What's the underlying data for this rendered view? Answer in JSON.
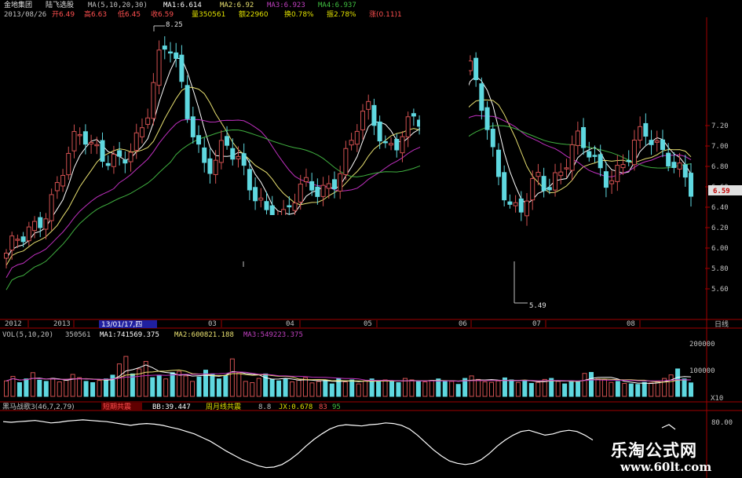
{
  "header": {
    "stock_name": "金地集团",
    "indicator_name": "陆飞选股",
    "ma_title": "MA(5,10,20,30)",
    "ma1": "MA1:6.614",
    "ma2": "MA2:6.92",
    "ma3": "MA3:6.923",
    "ma4": "MA4:6.937",
    "date": "2013/08/26",
    "open": "开6.49",
    "high": "高6.63",
    "low": "低6.45",
    "close": "收6.59",
    "volume": "量350561",
    "amount": "额22960",
    "turnover": "换0.78%",
    "amplitude": "振2.78%",
    "change": "涨(0.11)1"
  },
  "price_panel": {
    "high_label": "8.25",
    "low_label": "5.49",
    "current_price": "6.59",
    "y_ticks": [
      "7.20",
      "7.00",
      "6.80",
      "6.60",
      "6.40",
      "6.20",
      "6.00",
      "5.80",
      "5.60"
    ]
  },
  "x_axis": {
    "labels": [
      "2012",
      "2013",
      "13/01/17,四",
      "03",
      "04",
      "05",
      "06",
      "07",
      "08"
    ],
    "period": "日线"
  },
  "volume_panel": {
    "title": "VOL(5,10,20)",
    "vol": "350561",
    "ma1": "MA1:741569.375",
    "ma2": "MA2:600821.188",
    "ma3": "MA3:549223.375",
    "y_ticks": [
      "200000",
      "100000"
    ],
    "unit": "X10"
  },
  "oscillator_panel": {
    "title": "黑马战歌3(46,7,2,79)",
    "signal_a": "短期共震",
    "bb": "BB:39.447",
    "signal_b": "周月线共震",
    "value_a": "8.8",
    "jx": "JX:0.678",
    "value_b": "83",
    "value_c": "95",
    "y_tick": "80.00"
  },
  "watermark": {
    "text": "乐淘公式网",
    "url": "www.60lt.com"
  },
  "colors": {
    "up": "#d05050",
    "down": "#5fd8e0",
    "ma1": "#ffffff",
    "ma2": "#e8e070",
    "ma3": "#c030c0",
    "ma4": "#40b040",
    "axis": "#a00000",
    "text_red": "#ff5050",
    "text_cyan": "#60e0e0",
    "text_yellow": "#e0e000"
  },
  "chart_data": {
    "type": "candlestick",
    "title": "金地集团",
    "period": "日线",
    "ylim": [
      5.4,
      8.3
    ],
    "y_ticks": [
      7.2,
      7.0,
      6.8,
      6.6,
      6.4,
      6.2,
      6.0,
      5.8,
      5.6
    ],
    "x_labels": [
      "2012",
      "2013",
      "03",
      "04",
      "05",
      "06",
      "07",
      "08"
    ],
    "annotations": [
      {
        "label": "8.25",
        "type": "high"
      },
      {
        "label": "5.49",
        "type": "low"
      },
      {
        "label": "6.59",
        "type": "last"
      }
    ],
    "last_bar": {
      "date": "2013/08/26",
      "open": 6.49,
      "high": 6.63,
      "low": 6.45,
      "close": 6.59
    },
    "moving_averages": [
      {
        "name": "MA1",
        "value": 6.614
      },
      {
        "name": "MA2",
        "value": 6.92
      },
      {
        "name": "MA3",
        "value": 6.923
      },
      {
        "name": "MA4",
        "value": 6.937
      }
    ],
    "close_path": [
      5.95,
      6.05,
      6.1,
      6.2,
      6.35,
      6.55,
      6.8,
      7.0,
      7.1,
      7.0,
      6.95,
      6.9,
      6.85,
      6.9,
      7.05,
      7.4,
      7.9,
      8.1,
      7.75,
      7.3,
      6.95,
      6.8,
      6.9,
      7.1,
      6.9,
      6.7,
      6.5,
      6.4,
      6.35,
      6.3,
      6.45,
      6.55,
      6.6,
      6.55,
      6.65,
      6.75,
      6.95,
      7.2,
      7.35,
      7.2,
      7.0,
      7.05,
      7.15,
      7.25,
      7.2,
      7.05,
      7.3,
      7.55,
      7.75,
      7.7,
      7.4,
      7.0,
      6.7,
      6.4,
      6.35,
      6.5,
      6.7,
      6.6,
      6.75,
      6.9,
      7.05,
      6.95,
      6.8,
      6.7,
      6.75,
      6.85,
      7.0,
      7.1,
      7.05,
      6.95,
      6.9,
      6.75,
      6.55
    ]
  },
  "volume_chart_data": {
    "type": "bar",
    "ylim": [
      0,
      220000
    ],
    "y_ticks": [
      200000,
      100000
    ],
    "last_volume": 350561,
    "bars": [
      62,
      80,
      55,
      70,
      95,
      65,
      60,
      72,
      58,
      66,
      88,
      75,
      60,
      55,
      64,
      70,
      85,
      130,
      160,
      90,
      110,
      140,
      75,
      85,
      70,
      95,
      100,
      82,
      60,
      78,
      105,
      90,
      70,
      82,
      150,
      95,
      60,
      55,
      72,
      90,
      68,
      62,
      70,
      58,
      66,
      75,
      54,
      60,
      64,
      50,
      72,
      58,
      66,
      50,
      62,
      70,
      58,
      66,
      60,
      55,
      72,
      66,
      60,
      58,
      64,
      70,
      62,
      60,
      48,
      72,
      82,
      68,
      58,
      56,
      62,
      74,
      66,
      56,
      64,
      52,
      56,
      68,
      72,
      60,
      50,
      62,
      58,
      92,
      96,
      70,
      66,
      56,
      60,
      52,
      50,
      48,
      56,
      54,
      60,
      72,
      86,
      110,
      70,
      54
    ]
  },
  "oscillator_chart_data": {
    "type": "line",
    "y_tick": 80,
    "values": [
      92,
      91,
      92,
      93,
      94,
      92,
      90,
      91,
      93,
      94,
      95,
      94,
      93,
      92,
      90,
      88,
      86,
      88,
      89,
      88,
      86,
      83,
      80,
      76,
      72,
      66,
      60,
      52,
      44,
      37,
      30,
      25,
      20,
      17,
      18,
      22,
      30,
      40,
      52,
      63,
      72,
      80,
      85,
      87,
      86,
      85,
      87,
      88,
      90,
      89,
      86,
      80,
      70,
      58,
      46,
      36,
      28,
      24,
      22,
      24,
      30,
      40,
      52,
      62,
      70,
      76,
      78,
      74,
      70,
      72,
      76,
      78,
      76,
      70,
      62
    ]
  }
}
